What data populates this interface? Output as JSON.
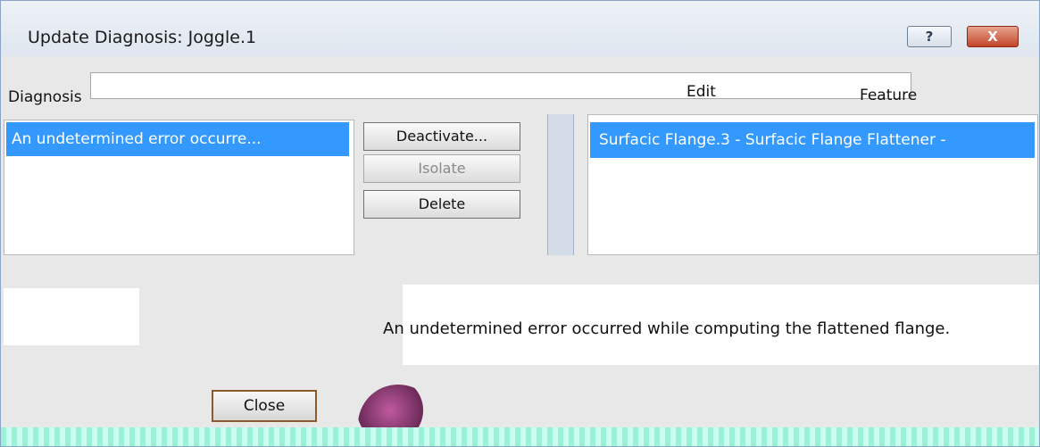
{
  "window": {
    "title": "Update Diagnosis: Joggle.1",
    "help_label": "?",
    "close_label": "X"
  },
  "columns": {
    "diagnosis": "Diagnosis",
    "edit": "Edit",
    "feature": "Feature"
  },
  "left_list": {
    "selected": "An undetermined error occurre..."
  },
  "buttons": {
    "deactivate": "Deactivate...",
    "isolate": "Isolate",
    "delete": "Delete",
    "close": "Close"
  },
  "right_list": {
    "selected": "Surfacic Flange.3    - Surfacic Flange Flattener -"
  },
  "message": {
    "text": "An undetermined error occurred while computing the flattened flange."
  },
  "colors": {
    "selection": "#3399ff",
    "close_button": "#c1462a"
  }
}
